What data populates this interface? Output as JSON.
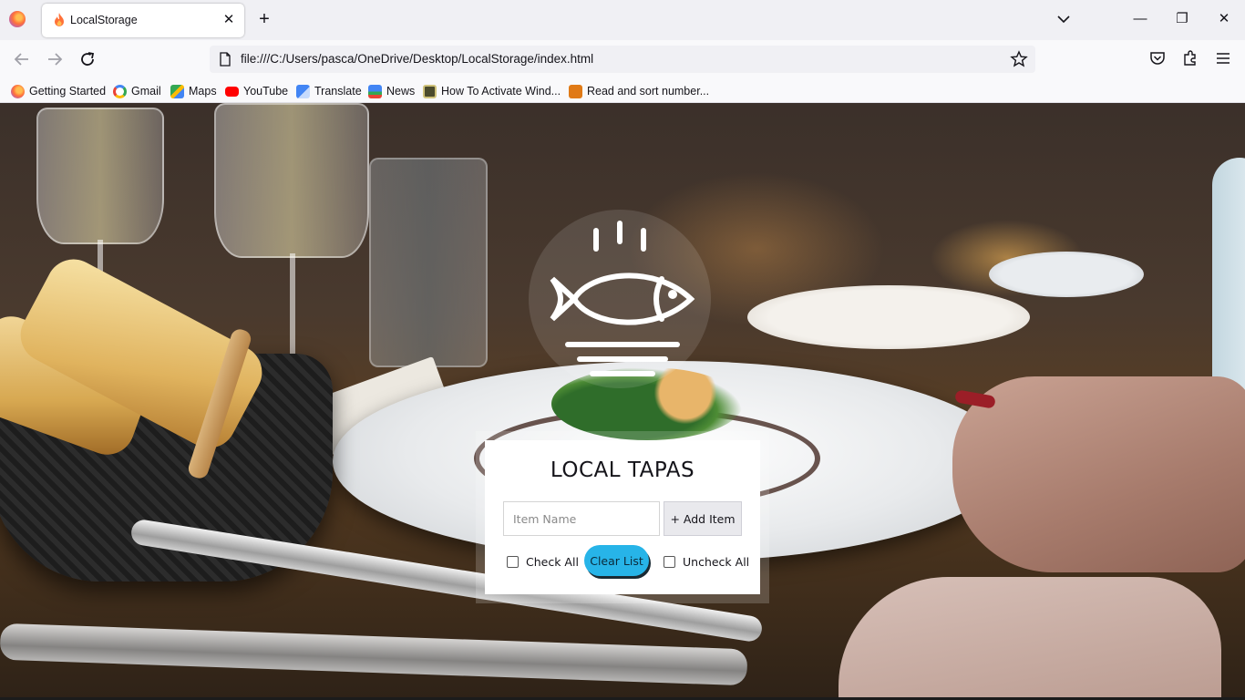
{
  "browser": {
    "tab": {
      "title": "LocalStorage",
      "close_glyph": "✕"
    },
    "new_tab_glyph": "+",
    "window_controls": {
      "minimize": "—",
      "maximize": "❐",
      "close": "✕"
    },
    "url": "file:///C:/Users/pasca/OneDrive/Desktop/LocalStorage/index.html",
    "bookmarks": [
      {
        "label": "Getting Started",
        "icon": "firefox-icon"
      },
      {
        "label": "Gmail",
        "icon": "google-icon"
      },
      {
        "label": "Maps",
        "icon": "maps-icon"
      },
      {
        "label": "YouTube",
        "icon": "youtube-icon"
      },
      {
        "label": "Translate",
        "icon": "translate-icon"
      },
      {
        "label": "News",
        "icon": "news-icon"
      },
      {
        "label": "How To Activate Wind...",
        "icon": "page-icon"
      },
      {
        "label": "Read and sort number...",
        "icon": "page-icon"
      }
    ]
  },
  "app": {
    "title": "LOCAL TAPAS",
    "logo": "fish-plate-icon",
    "input": {
      "placeholder": "Item Name",
      "value": ""
    },
    "add_button": "+ Add Item",
    "check_all": "Check All",
    "clear_list": "Clear List",
    "uncheck_all": "Uncheck All"
  },
  "colors": {
    "accent": "#27b4e8",
    "card": "#ffffff",
    "firefox_orange": "#ff7139"
  }
}
